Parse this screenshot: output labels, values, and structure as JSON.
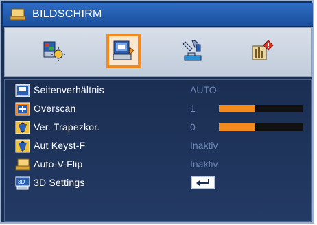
{
  "window": {
    "title": "BILDSCHIRM"
  },
  "tabs": [
    {
      "name": "bild",
      "active": false
    },
    {
      "name": "bildschirm",
      "active": true
    },
    {
      "name": "einstellungen",
      "active": false
    },
    {
      "name": "optionen",
      "active": false
    }
  ],
  "items": [
    {
      "label": "Seitenverhältnis",
      "value": "AUTO"
    },
    {
      "label": "Overscan",
      "value": "1",
      "slider": 0.43
    },
    {
      "label": "Ver. Trapezkor.",
      "value": "0",
      "slider": 0.43
    },
    {
      "label": "Aut Keyst-F",
      "value": "Inaktiv"
    },
    {
      "label": "Auto-V-Flip",
      "value": "Inaktiv"
    },
    {
      "label": "3D Settings",
      "value": ""
    }
  ],
  "colors": {
    "accent": "#f28a1e",
    "value_text": "#6e8ab8",
    "title_bar": "#1a4e9b"
  }
}
